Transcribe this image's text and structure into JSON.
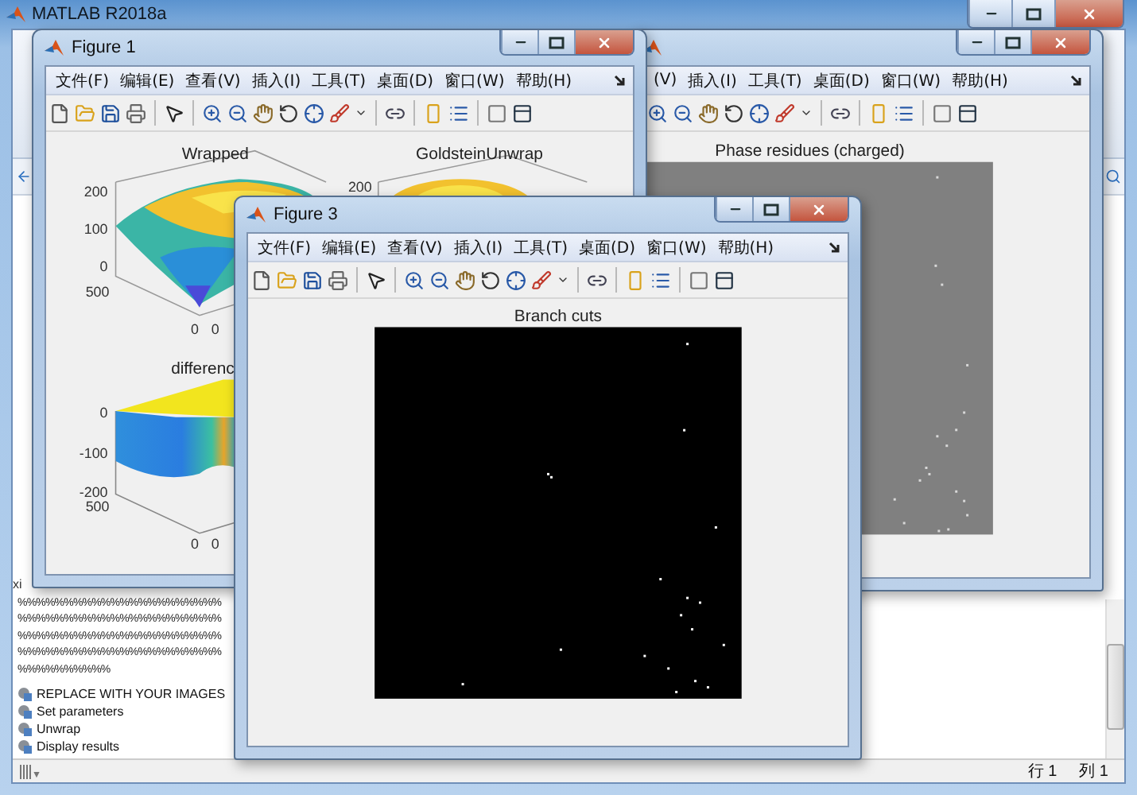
{
  "app": {
    "title": "MATLAB R2018a",
    "tab_stub": "xi",
    "editor_lines": [
      "%%%%%%%%%%%%%%%%%%%%%%",
      "%%%%%%%%%%%%%%%%%%%%%%",
      "%%%%%%%%%%%%%%%%%%%%%%",
      "%%%%%%%%%%%%%%%%%%%%%%",
      "%%%%%%%%%%"
    ],
    "sections": [
      "REPLACE WITH YOUR IMAGES",
      "Set parameters",
      "Unwrap",
      "Display results"
    ],
    "status": {
      "line": "行 1",
      "column": "列 1"
    }
  },
  "figures": [
    {
      "title": "Figure 1",
      "menu": [
        "文件(F)",
        "编辑(E)",
        "查看(V)",
        "插入(I)",
        "工具(T)",
        "桌面(D)",
        "窗口(W)",
        "帮助(H)"
      ],
      "plots": [
        {
          "kind": "bowl",
          "title": "Wrapped",
          "ticks": [
            "200",
            "100",
            "0",
            "500",
            "0",
            "0"
          ]
        },
        {
          "kind": "dome",
          "title": "GoldsteinUnwrap",
          "ticks": [
            "200"
          ]
        },
        {
          "kind": "slab",
          "title": "differenc",
          "ticks": [
            "0",
            "-100",
            "-200",
            "500",
            "0",
            "0"
          ]
        }
      ]
    },
    {
      "menu": [
        "(V)",
        "插入(I)",
        "工具(T)",
        "桌面(D)",
        "窗口(W)",
        "帮助(H)"
      ],
      "plots": [
        {
          "kind": "residues",
          "title": "Phase residues (charged)"
        }
      ]
    },
    {
      "title": "Figure 3",
      "menu": [
        "文件(F)",
        "编辑(E)",
        "查看(V)",
        "插入(I)",
        "工具(T)",
        "桌面(D)",
        "窗口(W)",
        "帮助(H)"
      ],
      "plots": [
        {
          "kind": "cuts",
          "title": "Branch cuts"
        }
      ]
    }
  ]
}
